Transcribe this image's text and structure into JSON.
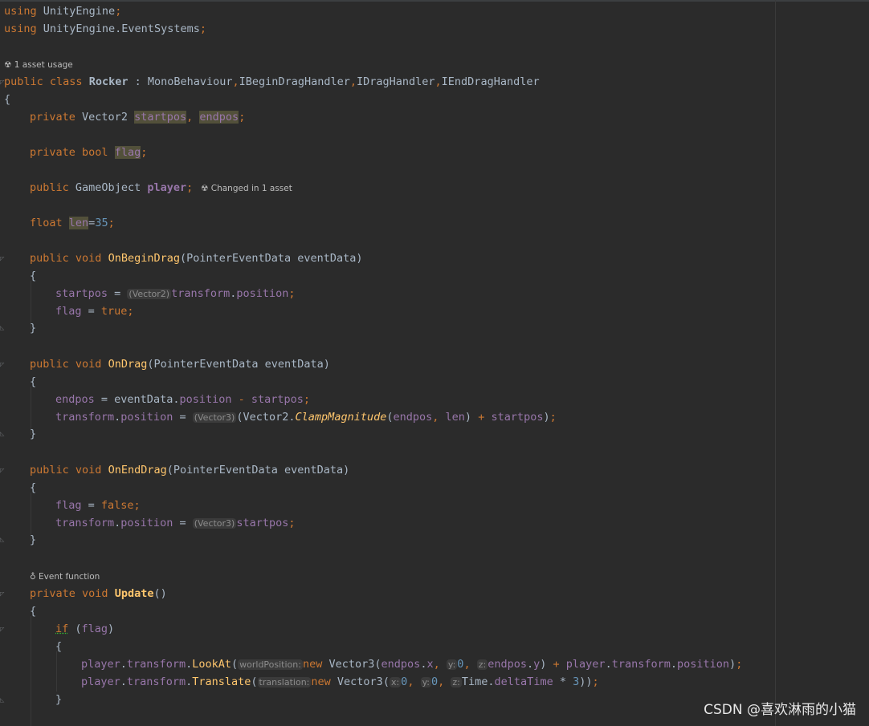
{
  "hints": {
    "asset_usage": "1 asset usage",
    "changed_in_asset": "Changed in 1 asset",
    "event_function": "Event function"
  },
  "code": {
    "l1_using": "using",
    "l1_ns": " UnityEngine",
    "l2_using": "using",
    "l2_ns": " UnityEngine.EventSystems",
    "semi": ";",
    "public": "public",
    "private": "private",
    "class": "class",
    "void": "void",
    "bool": "bool",
    "float": "float",
    "new": "new",
    "true": "true",
    "false": "false",
    "if": "if",
    "class_name": "Rocker",
    "inherits": " : MonoBehaviour",
    "comma": ",",
    "iface1": "IBeginDragHandler",
    "iface2": "IDragHandler",
    "iface3": "IEndDragHandler",
    "brace_open": "{",
    "brace_close": "}",
    "vector2": "Vector2",
    "vector3": "Vector3",
    "startpos": "startpos",
    "endpos": "endpos",
    "flag": "flag",
    "gameobject": "GameObject",
    "player": "player",
    "len": "len",
    "len_val": "35",
    "on_begin_drag": "OnBeginDrag",
    "on_drag": "OnDrag",
    "on_end_drag": "OnEndDrag",
    "update": "Update",
    "param": "(PointerEventData eventData)",
    "transform": "transform",
    "position": "position",
    "eventdata": "eventData",
    "clamp": "ClampMagnitude",
    "lookat": "LookAt",
    "translate": "Translate",
    "time": "Time",
    "deltatime": "deltaTime",
    "cast_v2": "(Vector2)",
    "cast_v3": "(Vector3)",
    "hint_worldpos": "worldPosition:",
    "hint_translation": "translation:",
    "hint_x": "x:",
    "hint_y": "y:",
    "hint_z": "z:",
    "zero": "0",
    "three": "3"
  },
  "watermark": "CSDN @喜欢淋雨的小猫"
}
